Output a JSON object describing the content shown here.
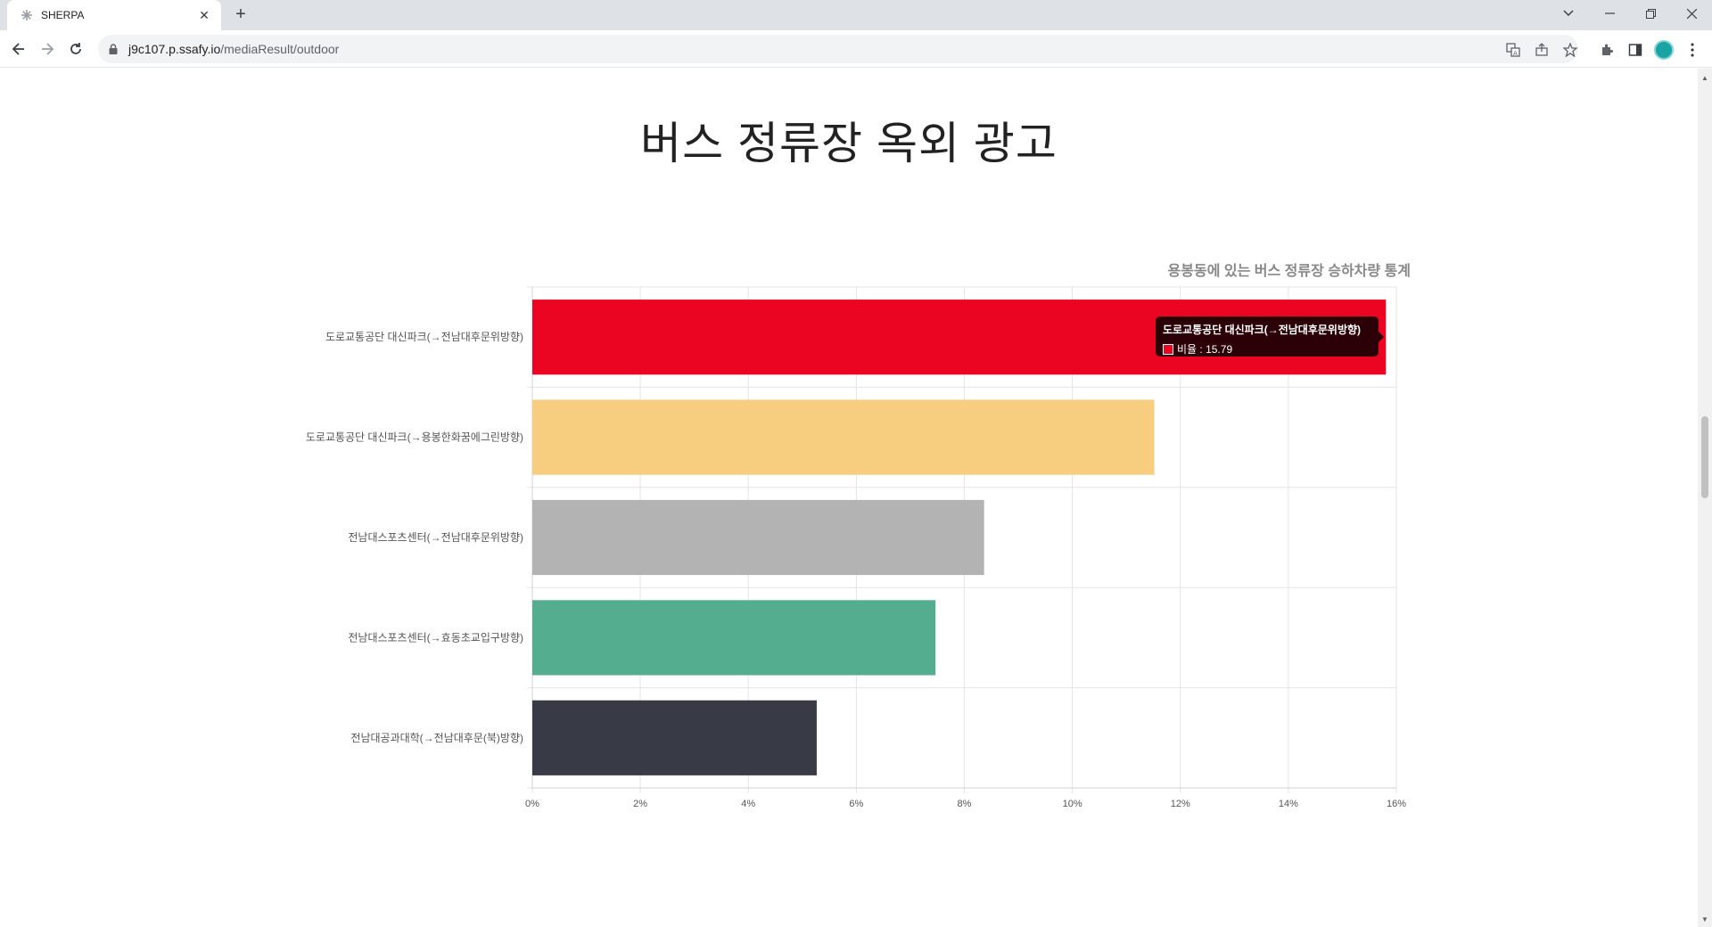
{
  "browser": {
    "tab_title": "SHERPA",
    "url_host": "j9c107.p.ssafy.io",
    "url_path": "/mediaResult/outdoor",
    "icons": [
      "favicon-icon",
      "close-tab-icon",
      "new-tab-icon",
      "back-icon",
      "forward-icon",
      "reload-icon",
      "lock-icon",
      "translate-icon",
      "share-icon",
      "bookmark-star-icon",
      "extensions-icon",
      "side-panel-icon",
      "profile-avatar",
      "menu-icon"
    ]
  },
  "page": {
    "heading": "버스 정류장 옥외 광고"
  },
  "chart_data": {
    "type": "bar",
    "orientation": "horizontal",
    "title": "용봉동에 있는 버스 정류장 승하차량 통계",
    "categories": [
      "도로교통공단 대신파크(→전남대후문위방향)",
      "도로교통공단 대신파크(→용봉한화꿈에그린방향)",
      "전남대스포츠센터(→전남대후문위방향)",
      "전남대스포츠센터(→효동초교입구방향)",
      "전남대공과대학(→전남대후문(북)방향)"
    ],
    "series": [
      {
        "name": "비율",
        "values": [
          15.79,
          11.5,
          8.35,
          7.45,
          5.25
        ]
      }
    ],
    "colors": [
      "#ec0522",
      "#f7cd7f",
      "#b3b3b3",
      "#54ad8f",
      "#383b46"
    ],
    "xlim": [
      0,
      16
    ],
    "x_ticks": [
      "0%",
      "2%",
      "4%",
      "6%",
      "8%",
      "10%",
      "12%",
      "14%",
      "16%"
    ],
    "grid": true,
    "tooltip": {
      "title": "도로교통공단 대신파크(→전남대후문위방향)",
      "label": "비율 : 15.79",
      "color": "#ec0522"
    }
  }
}
